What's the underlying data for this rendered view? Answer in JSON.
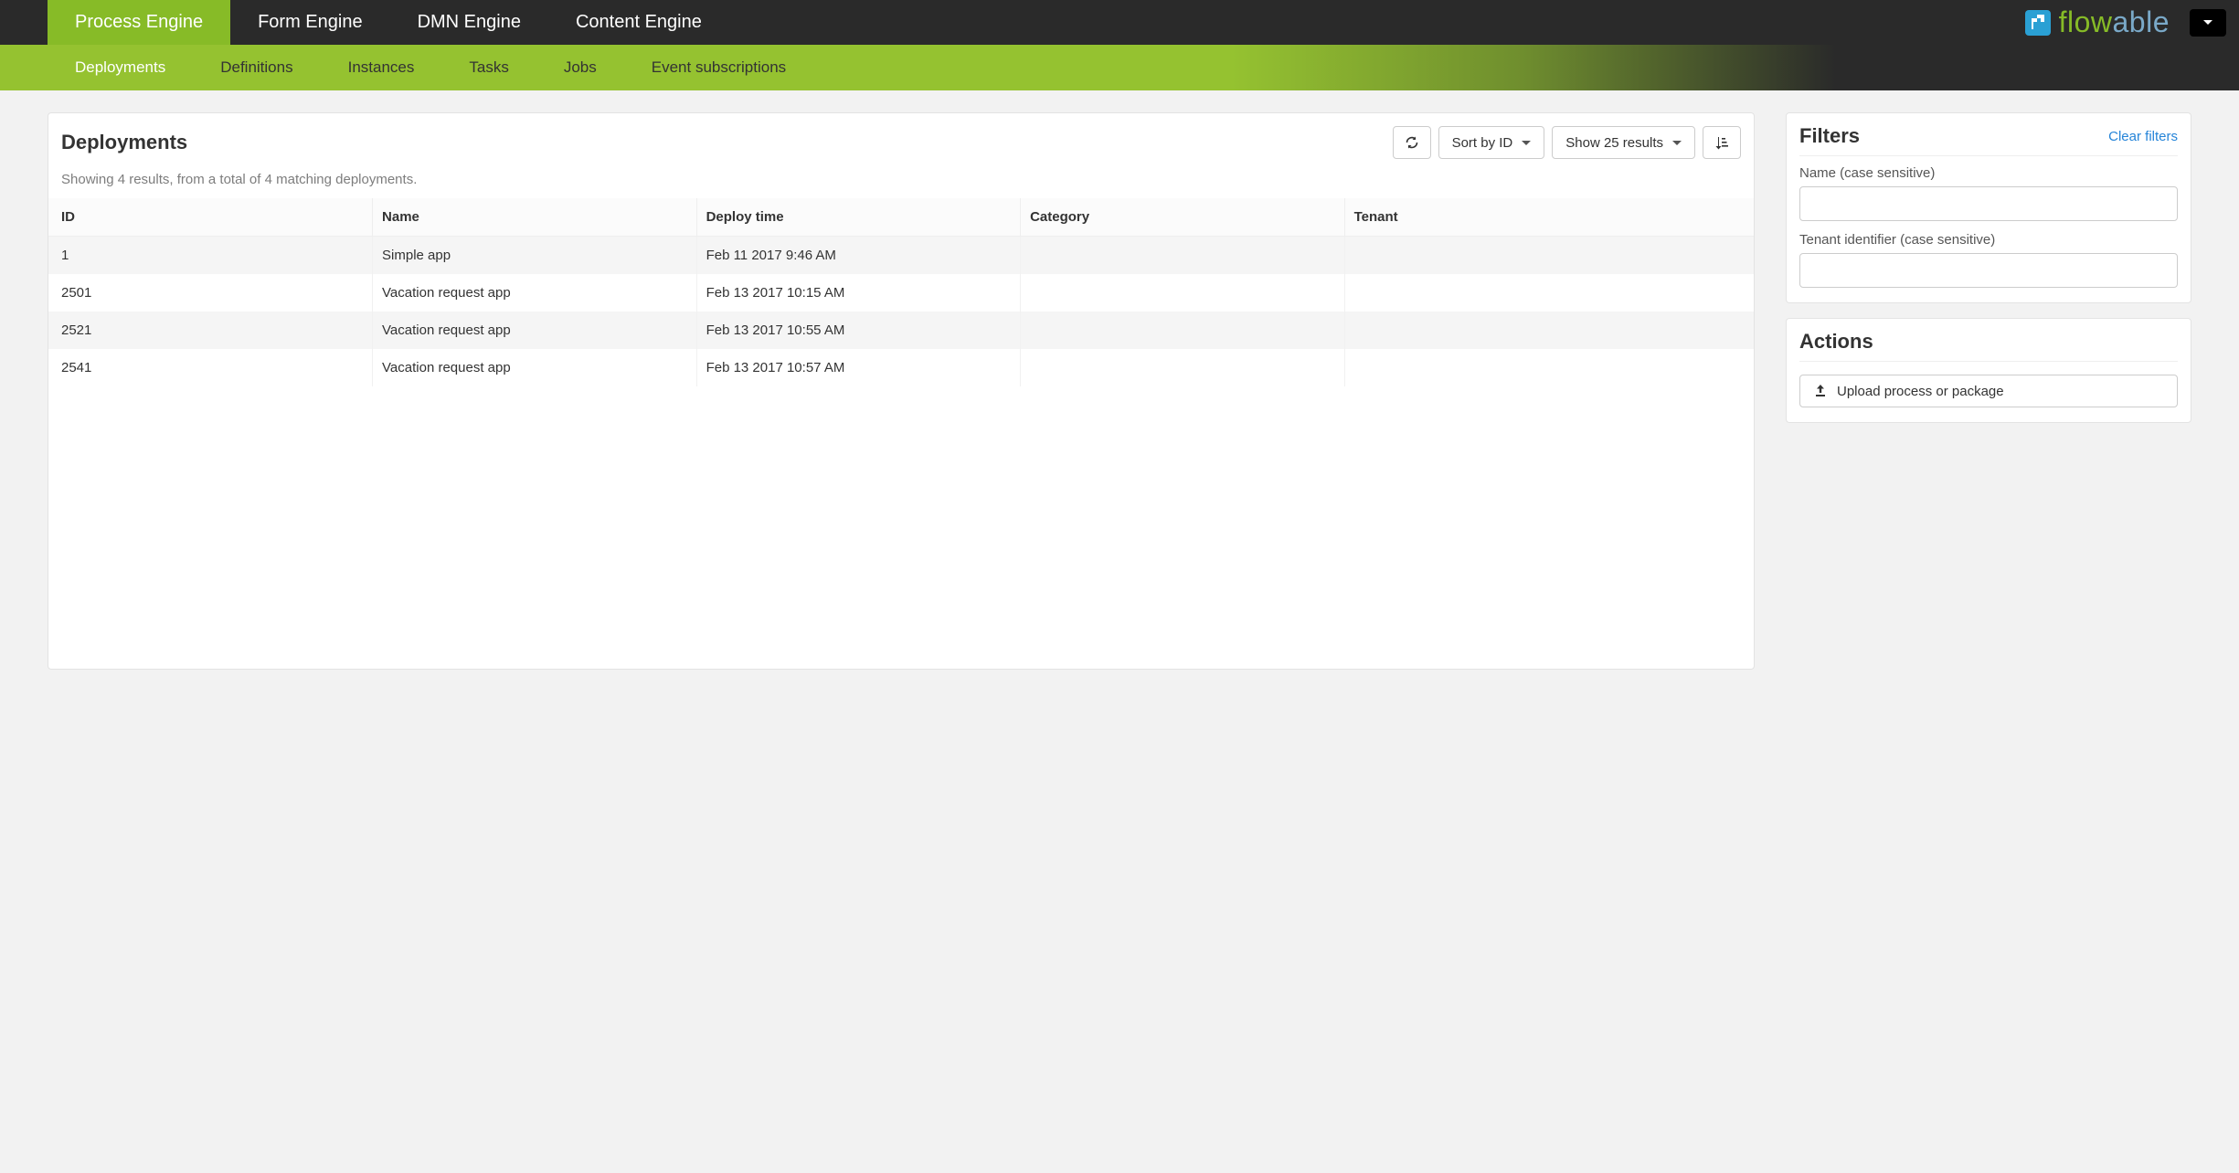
{
  "brand": {
    "name": "flowable",
    "color_flow": "#86bb27",
    "color_able": "#7aa9c8"
  },
  "topnav": {
    "active_index": 0,
    "items": [
      "Process Engine",
      "Form Engine",
      "DMN Engine",
      "Content Engine"
    ]
  },
  "subnav": {
    "active_index": 0,
    "items": [
      "Deployments",
      "Definitions",
      "Instances",
      "Tasks",
      "Jobs",
      "Event subscriptions"
    ]
  },
  "main": {
    "title": "Deployments",
    "toolbar": {
      "refresh_icon": "refresh",
      "sort_label": "Sort by ID",
      "page_size_label": "Show 25 results",
      "order_icon": "sort-asc"
    },
    "summary": "Showing 4 results, from a total of 4 matching deployments.",
    "table": {
      "columns": [
        "ID",
        "Name",
        "Deploy time",
        "Category",
        "Tenant"
      ],
      "rows": [
        {
          "id": "1",
          "name": "Simple app",
          "deploy_time": "Feb 11 2017 9:46 AM",
          "category": "",
          "tenant": ""
        },
        {
          "id": "2501",
          "name": "Vacation request app",
          "deploy_time": "Feb 13 2017 10:15 AM",
          "category": "",
          "tenant": ""
        },
        {
          "id": "2521",
          "name": "Vacation request app",
          "deploy_time": "Feb 13 2017 10:55 AM",
          "category": "",
          "tenant": ""
        },
        {
          "id": "2541",
          "name": "Vacation request app",
          "deploy_time": "Feb 13 2017 10:57 AM",
          "category": "",
          "tenant": ""
        }
      ]
    }
  },
  "filters": {
    "title": "Filters",
    "clear_label": "Clear filters",
    "fields": {
      "name": {
        "label": "Name (case sensitive)",
        "value": ""
      },
      "tenant": {
        "label": "Tenant identifier (case sensitive)",
        "value": ""
      }
    }
  },
  "actions": {
    "title": "Actions",
    "upload_label": "Upload process or package"
  }
}
